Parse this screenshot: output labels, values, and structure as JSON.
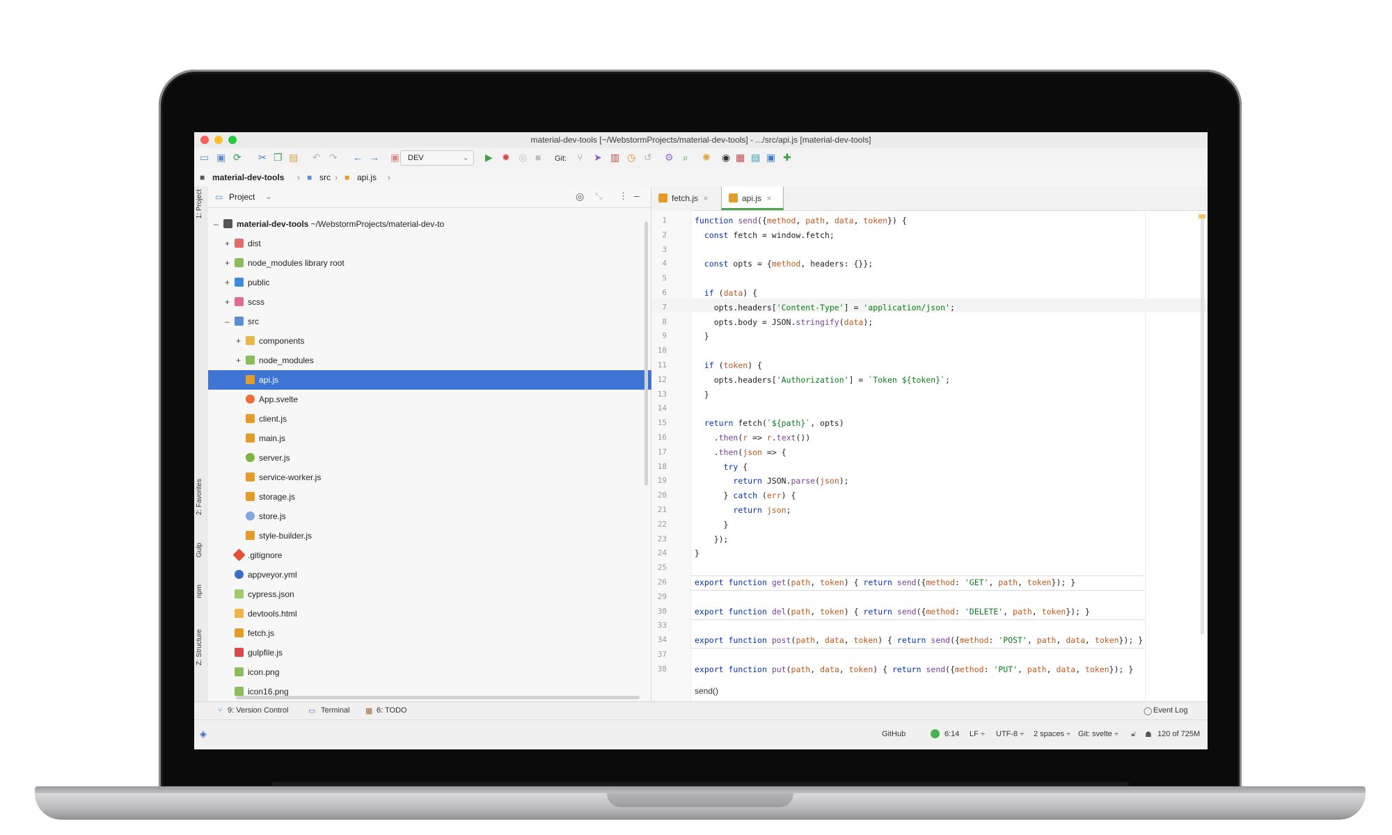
{
  "window": {
    "title": "material-dev-tools [~/WebstormProjects/material-dev-tools] - .../src/api.js [material-dev-tools]"
  },
  "toolbar": {
    "run_config": "DEV",
    "vcs_label": "Git:"
  },
  "breadcrumb": {
    "project": "material-dev-tools",
    "folder": "src",
    "file": "api.js"
  },
  "left_strip": {
    "project_tab": "1: Project",
    "favorites_tab": "2: Favorites",
    "gulp_tab": "Gulp",
    "npm_tab": "npm",
    "structure_tab": "Z: Structure"
  },
  "project_panel": {
    "header": "Project",
    "root": {
      "name": "material-dev-tools",
      "path": "~/WebstormProjects/material-dev-to"
    },
    "items": [
      {
        "name": "dist",
        "extra": ""
      },
      {
        "name": "node_modules",
        "extra": "library root"
      },
      {
        "name": "public",
        "extra": ""
      },
      {
        "name": "scss",
        "extra": ""
      },
      {
        "name": "src",
        "extra": ""
      },
      {
        "name": "components",
        "extra": ""
      },
      {
        "name": "node_modules",
        "extra": ""
      },
      {
        "name": "api.js",
        "extra": ""
      },
      {
        "name": "App.svelte",
        "extra": ""
      },
      {
        "name": "client.js",
        "extra": ""
      },
      {
        "name": "main.js",
        "extra": ""
      },
      {
        "name": "server.js",
        "extra": ""
      },
      {
        "name": "service-worker.js",
        "extra": ""
      },
      {
        "name": "storage.js",
        "extra": ""
      },
      {
        "name": "store.js",
        "extra": ""
      },
      {
        "name": "style-builder.js",
        "extra": ""
      },
      {
        "name": ".gitignore",
        "extra": ""
      },
      {
        "name": "appveyor.yml",
        "extra": ""
      },
      {
        "name": "cypress.json",
        "extra": ""
      },
      {
        "name": "devtools.html",
        "extra": ""
      },
      {
        "name": "fetch.js",
        "extra": ""
      },
      {
        "name": "gulpfile.js",
        "extra": ""
      },
      {
        "name": "icon.png",
        "extra": ""
      },
      {
        "name": "icon16.png",
        "extra": ""
      }
    ]
  },
  "editor": {
    "tabs": [
      {
        "label": "fetch.js"
      },
      {
        "label": "api.js"
      }
    ],
    "line_numbers": [
      "1",
      "2",
      "3",
      "4",
      "5",
      "6",
      "7",
      "8",
      "9",
      "10",
      "11",
      "12",
      "13",
      "14",
      "15",
      "16",
      "17",
      "18",
      "19",
      "20",
      "21",
      "22",
      "23",
      "24",
      "25",
      "26",
      "29",
      "30",
      "33",
      "34",
      "37",
      "38"
    ],
    "lines": [
      "function send({method, path, data, token}) {",
      "  const fetch = window.fetch;",
      "",
      "  const opts = {method, headers: {}};",
      "",
      "  if (data) {",
      "    opts.headers['Content-Type'] = 'application/json';",
      "    opts.body = JSON.stringify(data);",
      "  }",
      "",
      "  if (token) {",
      "    opts.headers['Authorization'] = `Token ${token}`;",
      "  }",
      "",
      "  return fetch(`${path}`, opts)",
      "    .then(r => r.text())",
      "    .then(json => {",
      "      try {",
      "        return JSON.parse(json);",
      "      } catch (err) {",
      "        return json;",
      "      }",
      "    });",
      "}",
      "",
      "export function get(path, token) { return send({method: 'GET', path, token}); }",
      "",
      "export function del(path, token) { return send({method: 'DELETE', path, token}); }",
      "",
      "export function post(path, data, token) { return send({method: 'POST', path, data, token}); }",
      "",
      "export function put(path, data, token) { return send({method: 'PUT', path, data, token}); }"
    ],
    "bottom_crumb": "send()"
  },
  "bottom_tools": {
    "version_control": "9: Version Control",
    "terminal": "Terminal",
    "todo": "6: TODO",
    "event_log": "Event Log"
  },
  "status_bar": {
    "github": "GitHub",
    "position": "6:14",
    "line_sep": "LF ÷",
    "encoding": "UTF-8 ÷",
    "indent": "2 spaces ÷",
    "branch": "Git: svelte ÷",
    "memory": "120 of 725M"
  }
}
